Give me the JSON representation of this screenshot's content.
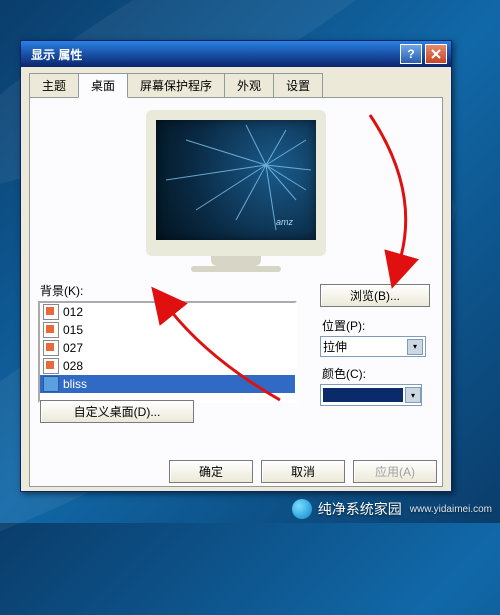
{
  "window": {
    "title": "显示 属性"
  },
  "tabs": [
    {
      "id": "theme",
      "label": "主题"
    },
    {
      "id": "desktop",
      "label": "桌面"
    },
    {
      "id": "screensaver",
      "label": "屏幕保护程序"
    },
    {
      "id": "appearance",
      "label": "外观"
    },
    {
      "id": "settings",
      "label": "设置"
    }
  ],
  "active_tab": "desktop",
  "desktop": {
    "bg_label": "背景(K):",
    "items": [
      {
        "name": "012",
        "type": "html"
      },
      {
        "name": "015",
        "type": "html"
      },
      {
        "name": "027",
        "type": "html"
      },
      {
        "name": "028",
        "type": "html"
      },
      {
        "name": "bliss",
        "type": "bmp",
        "selected": true
      }
    ],
    "browse_label": "浏览(B)...",
    "position_label": "位置(P):",
    "position_value": "拉伸",
    "color_label": "颜色(C):",
    "color_value": "#0a2a6a",
    "custom_label": "自定义桌面(D)..."
  },
  "buttons": {
    "ok": "确定",
    "cancel": "取消",
    "apply": "应用(A)"
  },
  "watermark": {
    "brand": "纯净系统家园",
    "url": "www.yidaimei.com"
  }
}
